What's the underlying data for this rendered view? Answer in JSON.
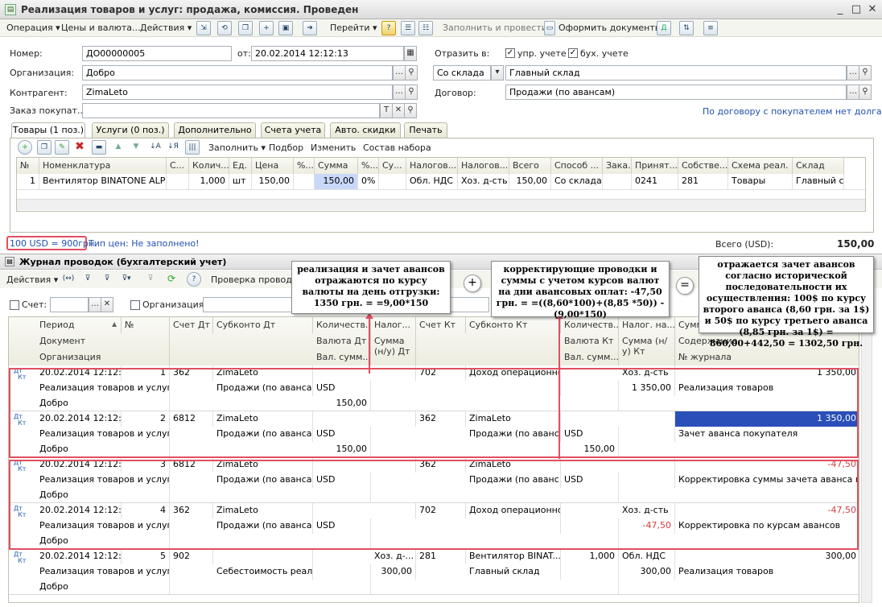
{
  "window": {
    "title": "Реализация товаров и услуг: продажа, комиссия. Проведен"
  },
  "toolbar": {
    "operation": "Операция",
    "prices": "Цены и валюта...",
    "actions": "Действия",
    "goto": "Перейти",
    "fill_post": "Заполнить и провести",
    "make_docs": "Оформить документы"
  },
  "header": {
    "number_label": "Номер:",
    "number_value": "ДО00000005",
    "from_label": "от:",
    "date_value": "20.02.2014 12:12:13",
    "reflect_label": "Отразить в:",
    "upr_label": "упр. учете",
    "buh_label": "бух. учете",
    "org_label": "Организация:",
    "org_value": "Добро",
    "from_warehouse": "Со склада",
    "warehouse_value": "Главный склад",
    "counterparty_label": "Контрагент:",
    "counterparty_value": "ZimaLeto",
    "contract_label": "Договор:",
    "contract_value": "Продажи (по авансам)",
    "order_label": "Заказ покупат...",
    "debt_link": "По договору с покупателем нет долга"
  },
  "tabs": [
    "Товары (1 поз.)",
    "Услуги (0 поз.)",
    "Дополнительно",
    "Счета учета",
    "Авто. скидки",
    "Печать"
  ],
  "goods_toolbar": {
    "fill": "Заполнить",
    "pick": "Подбор",
    "change": "Изменить",
    "set": "Состав набора"
  },
  "goods_table": {
    "headers": [
      "№",
      "Номенклатура",
      "С...",
      "Колич...",
      "Ед.",
      "Цена",
      "%...",
      "Сумма",
      "%...",
      "Су...",
      "Налогов...",
      "Налогов...",
      "Всего",
      "Способ ...",
      "Зака...",
      "Принят...",
      "Собстве...",
      "Схема реал.",
      "Склад"
    ],
    "rows": [
      [
        "1",
        "Вентилятор BINATONE ALPI...",
        "",
        "1,000",
        "шт",
        "150,00",
        "",
        "150,00",
        "0%",
        "",
        "Обл. НДС",
        "Хоз. д-сть",
        "150,00",
        "Со склада",
        "",
        "0241",
        "281",
        "Товары",
        "Главный склад"
      ]
    ]
  },
  "footer": {
    "rate": "100 USD = 900грн.",
    "price_type": "Тип цен: Не заполнено!",
    "total_label": "Всего (USD):",
    "total_value": "150,00"
  },
  "journal": {
    "title": "Журнал проводок (бухгалтерский учет)",
    "actions": "Действия",
    "check": "Проверка проводок",
    "account_label": "Счет:",
    "org_label": "Организация:",
    "headers_row1": [
      "Период",
      "№",
      "Счет Дт",
      "Субконто Дт",
      "Количеств...",
      "Налог...",
      "Счет Кт",
      "Субконто Кт",
      "Количеств...",
      "Налог. на...",
      "Сумма"
    ],
    "headers_row2": [
      "Документ",
      "Валюта Дт",
      "Сумма (н/у) Дт",
      "Валюта Кт",
      "Сумма (н/у) Кт",
      "Содержание"
    ],
    "headers_row3": [
      "Организация",
      "Вал. сумм...",
      "Вал. сумм...",
      "№ журнала"
    ],
    "rows": [
      {
        "period": "20.02.2014 12:12:...",
        "num": "1",
        "dt": "362",
        "sub_dt1": "ZimaLeto",
        "sub_dt2": "Продажи (по авансам)",
        "doc": "Реализация товаров и услуг ...",
        "org": "Добро",
        "cur_dt": "USD",
        "valsum_dt": "150,00",
        "nal_dt": "",
        "kt": "702",
        "sub_kt1": "Доход операционно...",
        "sub_kt2": "",
        "cur_kt": "",
        "valsum_kt": "",
        "nal_kt": "Хоз. д-сть",
        "nu_kt": "1 350,00",
        "sum": "1 350,00",
        "content": "Реализация товаров"
      },
      {
        "period": "20.02.2014 12:12:...",
        "num": "2",
        "dt": "6812",
        "sub_dt1": "ZimaLeto",
        "sub_dt2": "Продажи (по авансам)",
        "doc": "Реализация товаров и услуг ...",
        "org": "Добро",
        "cur_dt": "USD",
        "valsum_dt": "150,00",
        "nal_dt": "",
        "kt": "362",
        "sub_kt1": "ZimaLeto",
        "sub_kt2": "Продажи (по аванс...",
        "cur_kt": "USD",
        "valsum_kt": "150,00",
        "nal_kt": "",
        "nu_kt": "",
        "sum": "1 350,00",
        "content": "Зачет аванса покупателя"
      },
      {
        "period": "20.02.2014 12:12:...",
        "num": "3",
        "dt": "6812",
        "sub_dt1": "ZimaLeto",
        "sub_dt2": "Продажи (по авансам)",
        "doc": "Реализация товаров и услуг ...",
        "org": "Добро",
        "cur_dt": "USD",
        "valsum_dt": "",
        "nal_dt": "",
        "kt": "362",
        "sub_kt1": "ZimaLeto",
        "sub_kt2": "Продажи (по аванс...",
        "cur_kt": "USD",
        "valsum_kt": "",
        "nal_kt": "",
        "nu_kt": "",
        "sum": "-47,50",
        "content": "Корректировка суммы зачета аванса по ..."
      },
      {
        "period": "20.02.2014 12:12:...",
        "num": "4",
        "dt": "362",
        "sub_dt1": "ZimaLeto",
        "sub_dt2": "Продажи (по авансам)",
        "doc": "Реализация товаров и услуг ...",
        "org": "Добро",
        "cur_dt": "USD",
        "valsum_dt": "",
        "nal_dt": "",
        "kt": "702",
        "sub_kt1": "Доход операционно...",
        "sub_kt2": "",
        "cur_kt": "",
        "valsum_kt": "",
        "nal_kt": "Хоз. д-сть",
        "nu_kt": "-47,50",
        "sum": "-47,50",
        "content": "Корректировка по курсам авансов"
      },
      {
        "period": "20.02.2014 12:12:...",
        "num": "5",
        "dt": "902",
        "sub_dt1": "",
        "sub_dt2": "Себестоимость реал...",
        "doc": "Реализация товаров и услуг ...",
        "org": "Добро",
        "cur_dt": "",
        "valsum_dt": "",
        "nal_dt": "Хоз. д-...",
        "nu_dt": "300,00",
        "kt": "281",
        "sub_kt1": "Вентилятор BINAT...",
        "sub_kt2": "Главный склад",
        "qty_kt": "1,000",
        "cur_kt": "",
        "valsum_kt": "",
        "nal_kt": "Обл. НДС",
        "nu_kt": "300,00",
        "sum": "300,00",
        "content": "Реализация товаров"
      }
    ]
  },
  "notes": {
    "note1": "реализация и зачет авансов отражаются по курсу валюты на день отгрузки: 1350 грн. = =9,00*150",
    "note2": "корректирующие проводки и суммы с учетом курсов валют на дни авансовых оплат: -47,50 грн. = =((8,60*100)+(8,85 *50)) - (9,00*150)",
    "note3": "отражается зачет авансов согласно исторической последовательности их осуществления: 100$ по курсу второго аванса (8,60 грн. за 1$) и 50$ по курсу третьего аванса (8,85 грн. за 1$) = 860,00+442,50 = 1302,50 грн.",
    "plus": "+",
    "equals": "="
  },
  "colors": {
    "highlight": "#e05060",
    "selection": "#2a4fb8",
    "link": "#2050b0"
  }
}
